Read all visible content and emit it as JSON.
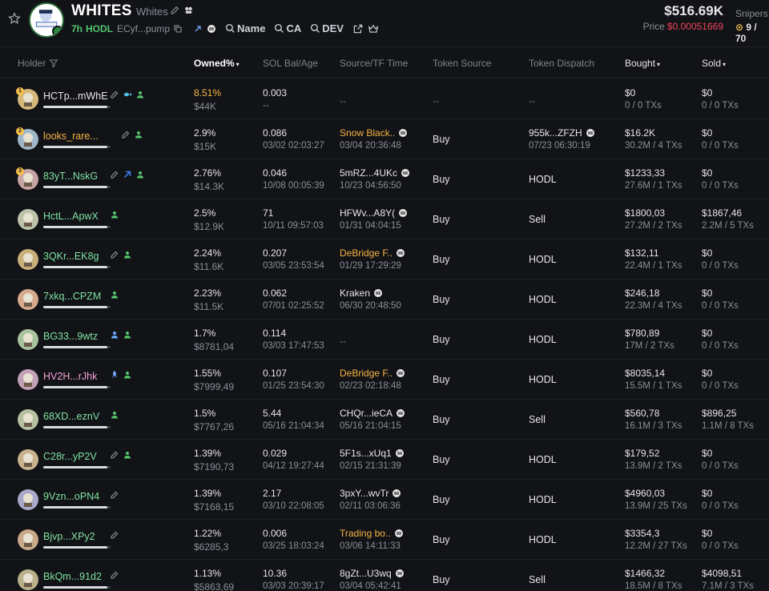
{
  "token": {
    "symbol": "WHITES",
    "name": "Whites",
    "age": "7h",
    "hodl_label": "HODL",
    "ca_short": "ECyf...pump",
    "logo_text": "WHITES",
    "search_labels": [
      "Name",
      "CA",
      "DEV"
    ],
    "market_cap": "$516.69K",
    "price_label": "Price",
    "price_value": "$0.00051669",
    "snipers_label": "Snipers",
    "snipers_value": "9 / 70"
  },
  "colors": {
    "background": "#121317",
    "accent_green": "#52c46d",
    "price_red": "#f0445a",
    "highlight_orange": "#f5b342",
    "wallet_green": "#7ee2a0",
    "wallet_pink": "#f4a4d4"
  },
  "columns": [
    {
      "label": "Holder",
      "icon": "filter-icon"
    },
    {
      "label": "Owned%",
      "active": true,
      "caret": "▾"
    },
    {
      "label": "SOL Bal/Age"
    },
    {
      "label": "Source/TF Time"
    },
    {
      "label": "Token Source"
    },
    {
      "label": "Token Dispatch"
    },
    {
      "label": "Bought",
      "caret": "▾"
    },
    {
      "label": "Sold",
      "caret": "▾"
    }
  ],
  "holders": [
    {
      "wallet": "HCTp...mWhE",
      "wallet_color": "#e6e6e6",
      "rank": "1",
      "icons": [
        "pencil-icon",
        "fish-icon",
        "user-icon"
      ],
      "bar": 0.95,
      "owned_pct": "8.51%",
      "owned_gold": true,
      "owned_usd": "$44K",
      "sol": "0.003",
      "sol_age": "--",
      "source": "--",
      "source_time": "",
      "token_source": "--",
      "dispatch": "--",
      "dispatch_time": "",
      "bought": "$0",
      "bought_tx": "0 / 0 TXs",
      "sold": "$0",
      "sold_tx": "0 / 0 TXs"
    },
    {
      "wallet": "looks_rare...",
      "wallet_color": "#f5b342",
      "rank": "2",
      "icons": [
        "pencil-icon",
        "user-icon"
      ],
      "bar": 0.95,
      "owned_pct": "2.9%",
      "owned_usd": "$15K",
      "sol": "0.086",
      "sol_age": "03/02 02:03:27",
      "source": "Snow Black..",
      "source_orange": true,
      "source_pill": true,
      "source_time": "03/04 20:36:48",
      "token_source": "Buy",
      "dispatch": "955k...ZFZH",
      "dispatch_pill": true,
      "dispatch_time": "07/23 06:30:19",
      "bought": "$16.2K",
      "bought_tx": "30.2M / 4 TXs",
      "sold": "$0",
      "sold_tx": "0 / 0 TXs"
    },
    {
      "wallet": "83yT...NskG",
      "wallet_color": "#7ee2a0",
      "rank": "3",
      "icons": [
        "pencil-icon",
        "pump-icon",
        "user-icon"
      ],
      "bar": 0.95,
      "owned_pct": "2.76%",
      "owned_usd": "$14.3K",
      "sol": "0.046",
      "sol_age": "10/08 00:05:39",
      "source": "5mRZ...4UKc",
      "source_pill": true,
      "source_time": "10/23 04:56:50",
      "token_source": "Buy",
      "dispatch": "HODL",
      "dispatch_time": "",
      "bought": "$1233,33",
      "bought_tx": "27.6M / 1 TXs",
      "sold": "$0",
      "sold_tx": "0 / 0 TXs"
    },
    {
      "wallet": "HctL...ApwX",
      "wallet_color": "#7ee2a0",
      "rank": "",
      "icons": [
        "user-icon"
      ],
      "bar": 0.95,
      "owned_pct": "2.5%",
      "owned_usd": "$12.9K",
      "sol": "71",
      "sol_age": "10/11 09:57:03",
      "source": "HFWv...A8Y(",
      "source_pill": true,
      "source_time": "01/31 04:04:15",
      "token_source": "Buy",
      "dispatch": "Sell",
      "dispatch_time": "",
      "bought": "$1800,03",
      "bought_tx": "27.2M / 2 TXs",
      "sold": "$1867,46",
      "sold_tx": "2.2M / 5 TXs"
    },
    {
      "wallet": "3QKr...EK8g",
      "wallet_color": "#7ee2a0",
      "rank": "",
      "icons": [
        "pencil-icon",
        "user-icon"
      ],
      "bar": 0.95,
      "owned_pct": "2.24%",
      "owned_usd": "$11.6K",
      "sol": "0.207",
      "sol_age": "03/05 23:53:54",
      "source": "DeBridge F..",
      "source_orange": true,
      "source_pill": true,
      "source_time": "01/29 17:29:29",
      "token_source": "Buy",
      "dispatch": "HODL",
      "dispatch_time": "",
      "bought": "$132,11",
      "bought_tx": "22.4M / 1 TXs",
      "sold": "$0",
      "sold_tx": "0 / 0 TXs"
    },
    {
      "wallet": "7xkq...CPZM",
      "wallet_color": "#7ee2a0",
      "rank": "",
      "icons": [
        "user-icon"
      ],
      "bar": 0.95,
      "owned_pct": "2.23%",
      "owned_usd": "$11.5K",
      "sol": "0.062",
      "sol_age": "07/01 02:25:52",
      "source": "Kraken",
      "source_pill": true,
      "source_time": "06/30 20:48:50",
      "token_source": "Buy",
      "dispatch": "HODL",
      "dispatch_time": "",
      "bought": "$246,18",
      "bought_tx": "22.3M / 4 TXs",
      "sold": "$0",
      "sold_tx": "0 / 0 TXs"
    },
    {
      "wallet": "BG33...9wtz",
      "wallet_color": "#7ee2a0",
      "rank": "",
      "icons": [
        "user-blue-icon",
        "user-icon"
      ],
      "bar": 0.95,
      "owned_pct": "1.7%",
      "owned_usd": "$8781,04",
      "sol": "0.114",
      "sol_age": "03/03 17:47:53",
      "source": "--",
      "source_time": "",
      "token_source": "Buy",
      "dispatch": "HODL",
      "dispatch_time": "",
      "bought": "$780,89",
      "bought_tx": "17M / 2 TXs",
      "sold": "$0",
      "sold_tx": "0 / 0 TXs"
    },
    {
      "wallet": "HV2H...rJhk",
      "wallet_color": "#f4a4d4",
      "rank": "",
      "icons": [
        "rocket-icon",
        "user-icon"
      ],
      "bar": 0.95,
      "owned_pct": "1.55%",
      "owned_usd": "$7999,49",
      "sol": "0.107",
      "sol_age": "01/25 23:54:30",
      "source": "DeBridge F..",
      "source_orange": true,
      "source_pill": true,
      "source_time": "02/23 02:18:48",
      "token_source": "Buy",
      "dispatch": "HODL",
      "dispatch_time": "",
      "bought": "$8035,14",
      "bought_tx": "15.5M / 1 TXs",
      "sold": "$0",
      "sold_tx": "0 / 0 TXs"
    },
    {
      "wallet": "68XD...eznV",
      "wallet_color": "#7ee2a0",
      "rank": "",
      "icons": [
        "user-icon"
      ],
      "bar": 0.95,
      "owned_pct": "1.5%",
      "owned_usd": "$7767,26",
      "sol": "5.44",
      "sol_age": "05/16 21:04:34",
      "source": "CHQr...ieCA",
      "source_pill": true,
      "source_time": "05/16 21:04:15",
      "token_source": "Buy",
      "dispatch": "Sell",
      "dispatch_time": "",
      "bought": "$560,78",
      "bought_tx": "16.1M / 3 TXs",
      "sold": "$896,25",
      "sold_tx": "1.1M / 8 TXs"
    },
    {
      "wallet": "C28r...yP2V",
      "wallet_color": "#7ee2a0",
      "rank": "",
      "icons": [
        "pencil-icon",
        "user-icon"
      ],
      "bar": 0.95,
      "owned_pct": "1.39%",
      "owned_usd": "$7190,73",
      "sol": "0.029",
      "sol_age": "04/12 19:27:44",
      "source": "5F1s...xUq1",
      "source_pill": true,
      "source_time": "02/15 21:31:39",
      "token_source": "Buy",
      "dispatch": "HODL",
      "dispatch_time": "",
      "bought": "$179,52",
      "bought_tx": "13.9M / 2 TXs",
      "sold": "$0",
      "sold_tx": "0 / 0 TXs"
    },
    {
      "wallet": "9Vzn...oPN4",
      "wallet_color": "#7ee2a0",
      "rank": "",
      "icons": [
        "pencil-icon"
      ],
      "bar": 0.95,
      "owned_pct": "1.39%",
      "owned_usd": "$7168,15",
      "sol": "2.17",
      "sol_age": "03/10 22:08:05",
      "source": "3pxY...wvTr",
      "source_pill": true,
      "source_time": "02/11 03:06:36",
      "token_source": "Buy",
      "dispatch": "HODL",
      "dispatch_time": "",
      "bought": "$4960,03",
      "bought_tx": "13.9M / 25 TXs",
      "sold": "$0",
      "sold_tx": "0 / 0 TXs"
    },
    {
      "wallet": "Bjvp...XPy2",
      "wallet_color": "#7ee2a0",
      "rank": "",
      "icons": [
        "pencil-icon"
      ],
      "bar": 0.95,
      "owned_pct": "1.22%",
      "owned_usd": "$6285,3",
      "sol": "0.006",
      "sol_age": "03/25 18:03:24",
      "source": "Trading bo..",
      "source_orange": true,
      "source_pill": true,
      "source_time": "03/06 14:11:33",
      "token_source": "Buy",
      "dispatch": "HODL",
      "dispatch_time": "",
      "bought": "$3354,3",
      "bought_tx": "12.2M / 27 TXs",
      "sold": "$0",
      "sold_tx": "0 / 0 TXs"
    },
    {
      "wallet": "BkQm...91d2",
      "wallet_color": "#7ee2a0",
      "rank": "",
      "icons": [
        "pencil-icon"
      ],
      "bar": 0.95,
      "owned_pct": "1.13%",
      "owned_usd": "$5863,69",
      "sol": "10.36",
      "sol_age": "03/03 20:39:17",
      "source": "8gZt...U3wq",
      "source_pill": true,
      "source_time": "03/04 05:42:41",
      "token_source": "Buy",
      "dispatch": "Sell",
      "dispatch_time": "",
      "bought": "$1466,32",
      "bought_tx": "18.5M / 8 TXs",
      "sold": "$4098,51",
      "sold_tx": "7.1M / 3 TXs"
    }
  ]
}
